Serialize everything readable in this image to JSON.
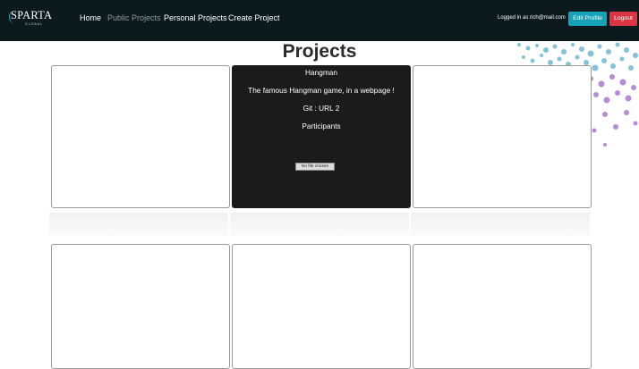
{
  "brand": {
    "name": "SPARTA",
    "tagline": "GLOBAL"
  },
  "nav": {
    "home": "Home",
    "public_projects": "Public Projects",
    "personal_projects": "Personal Projects",
    "create_project": "Create Project"
  },
  "user": {
    "logged_in_text": "Logged in as rich@mail.com",
    "edit_profile": "Edit Profile",
    "logout": "Logout"
  },
  "page": {
    "title": "Projects"
  },
  "featured_project": {
    "name": "Hangman",
    "description": "The famous Hangman game, in a webpage !",
    "git": "Git : URL 2",
    "participants_label": "Participants",
    "file_input_text": "No file chosen"
  },
  "colors": {
    "navbar": "#0c191d",
    "edit_button": "#17a2b8",
    "logout_button": "#dc3545",
    "card_dark": "#1b1b1b"
  }
}
